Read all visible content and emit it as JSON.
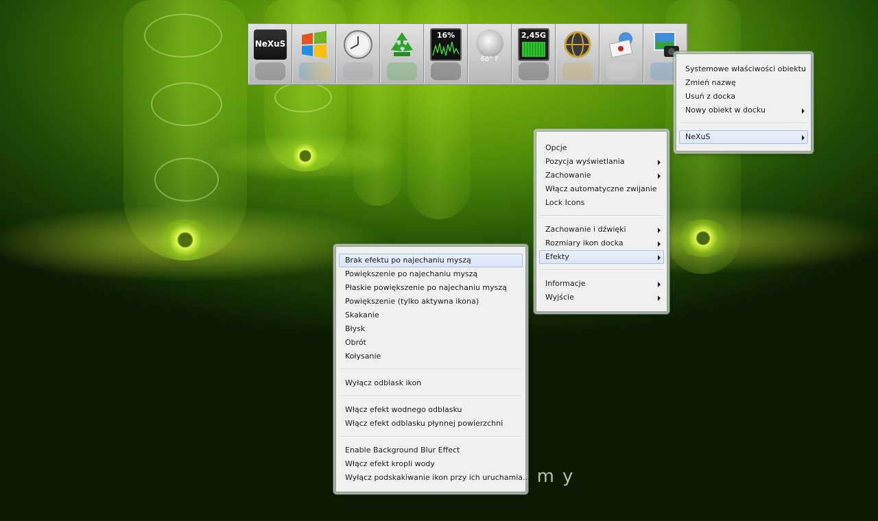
{
  "dock": {
    "items": [
      {
        "name": "nexus-icon",
        "label": "NeXuS"
      },
      {
        "name": "windows-logo-icon",
        "label": ""
      },
      {
        "name": "clock-icon",
        "label": ""
      },
      {
        "name": "recycle-bin-icon",
        "label": ""
      },
      {
        "name": "cpu-meter-icon",
        "label": "16%"
      },
      {
        "name": "weather-icon",
        "label": "68° F"
      },
      {
        "name": "memory-meter-icon",
        "label": "2,45G"
      },
      {
        "name": "globe-icon",
        "label": ""
      },
      {
        "name": "mail-icon",
        "label": ""
      },
      {
        "name": "photo-camera-icon",
        "label": ""
      }
    ]
  },
  "menu_item": {
    "items": [
      {
        "label": "Systemowe właściwości obiektu"
      },
      {
        "label": "Zmień nazwę"
      },
      {
        "label": "Usuń z docka"
      },
      {
        "label": "Nowy obiekt w docku",
        "submenu": true
      }
    ],
    "nexus_label": "NeXuS"
  },
  "menu_main": {
    "group1": [
      {
        "label": "Opcje"
      },
      {
        "label": "Pozycja wyświetlania",
        "submenu": true
      },
      {
        "label": "Zachowanie",
        "submenu": true
      },
      {
        "label": "Włącz automatyczne zwijanie"
      },
      {
        "label": "Lock Icons"
      }
    ],
    "group2": [
      {
        "label": "Zachowanie i dźwięki",
        "submenu": true
      },
      {
        "label": "Rozmiary ikon docka",
        "submenu": true
      },
      {
        "label": "Efekty",
        "submenu": true
      }
    ],
    "group3": [
      {
        "label": "Informacje",
        "submenu": true
      },
      {
        "label": "Wyjście",
        "submenu": true
      }
    ]
  },
  "menu_effects": {
    "group1": [
      "Brak efektu po najechaniu myszą",
      "Powiększenie po najechaniu myszą",
      "Płaskie powiększenie po najechaniu myszą",
      "Powiększenie (tylko aktywna ikona)",
      "Skakanie",
      "Błysk",
      "Obrót",
      "Kołysanie"
    ],
    "group2": [
      "Wyłącz odblask ikon"
    ],
    "group3": [
      "Włącz efekt wodnego odblasku",
      "Włącz efekt odblasku płynnej powierzchni"
    ],
    "group4": [
      "Enable Background Blur Effect",
      "Włącz efekt kropli wody",
      "Wyłącz podskakiwanie ikon przy ich uruchamia..."
    ]
  },
  "watermark": "dobreprogramy",
  "colors": {
    "accent": "#a8bfe0",
    "background": "#4d8a08"
  }
}
